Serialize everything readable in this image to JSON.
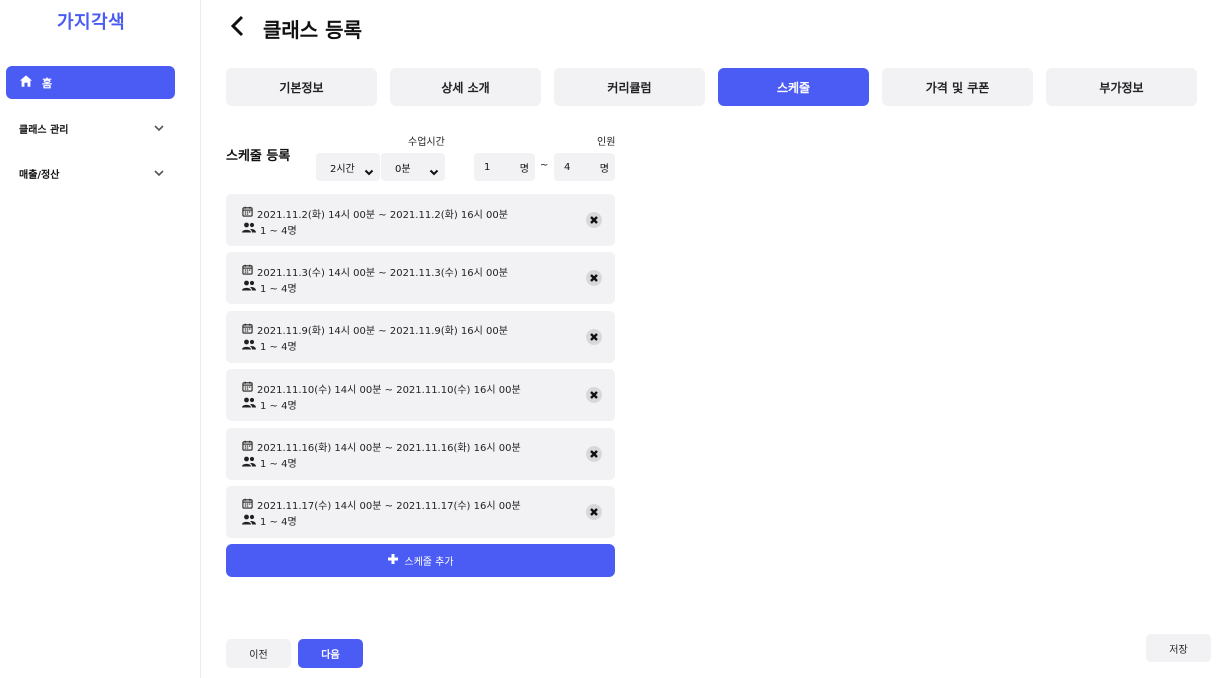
{
  "brand": {
    "logo": "가지각색",
    "accent": "#4b5cf5"
  },
  "sidebar": {
    "home": {
      "label": "홈",
      "icon": "home-icon"
    },
    "groups": [
      {
        "label": "클래스 관리",
        "icon": "chevron-down-icon"
      },
      {
        "label": "매출/정산",
        "icon": "chevron-down-icon"
      }
    ]
  },
  "header": {
    "title": "클래스 등록",
    "back_icon": "chevron-left-icon"
  },
  "tabs": [
    {
      "label": "기본정보",
      "active": false
    },
    {
      "label": "상세 소개",
      "active": false
    },
    {
      "label": "커리큘럼",
      "active": false
    },
    {
      "label": "스케줄",
      "active": true
    },
    {
      "label": "가격 및 쿠폰",
      "active": false
    },
    {
      "label": "부가정보",
      "active": false
    }
  ],
  "schedule_form": {
    "section_label": "스케줄 등록",
    "duration_label": "수업시간",
    "hours_value": "2시간",
    "minutes_value": "0분",
    "capacity_label": "인원",
    "min_value": "1",
    "max_value": "4",
    "unit": "명",
    "separator": "~"
  },
  "schedules": [
    {
      "time": "2021.11.2(화) 14시 00분 ~ 2021.11.2(화) 16시 00분",
      "people": "1 ~ 4명"
    },
    {
      "time": "2021.11.3(수) 14시 00분 ~ 2021.11.3(수) 16시 00분",
      "people": "1 ~ 4명"
    },
    {
      "time": "2021.11.9(화) 14시 00분 ~ 2021.11.9(화) 16시 00분",
      "people": "1 ~ 4명"
    },
    {
      "time": "2021.11.10(수) 14시 00분 ~ 2021.11.10(수) 16시 00분",
      "people": "1 ~ 4명"
    },
    {
      "time": "2021.11.16(화) 14시 00분 ~ 2021.11.16(화) 16시 00분",
      "people": "1 ~ 4명"
    },
    {
      "time": "2021.11.17(수) 14시 00분 ~ 2021.11.17(수) 16시 00분",
      "people": "1 ~ 4명"
    }
  ],
  "actions": {
    "add_schedule": "스케줄 추가",
    "prev": "이전",
    "next": "다음",
    "save": "저장"
  }
}
